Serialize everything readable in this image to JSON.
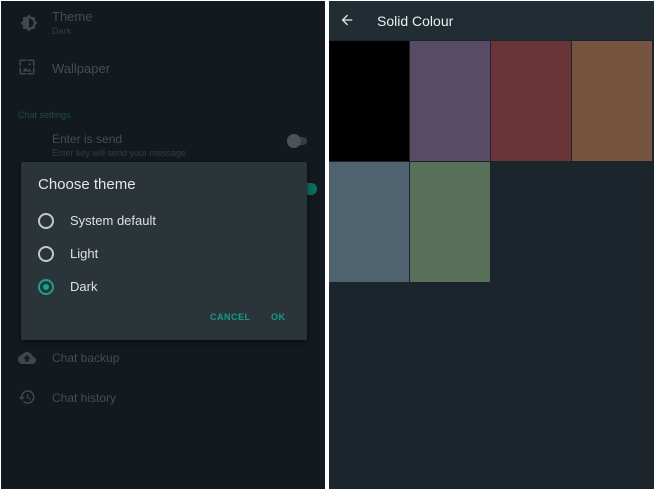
{
  "settings": {
    "theme": {
      "title": "Theme",
      "value": "Dark",
      "icon": "brightness-icon"
    },
    "wallpaper": {
      "title": "Wallpaper",
      "icon": "wallpaper-icon"
    },
    "chat_section": "Chat settings",
    "enter_send": {
      "title": "Enter is send",
      "subtitle": "Enter key will send your message",
      "enabled": false
    },
    "chat_backup": {
      "title": "Chat backup",
      "icon": "cloud-upload-icon"
    },
    "chat_history": {
      "title": "Chat history",
      "icon": "history-icon"
    }
  },
  "dialog": {
    "title": "Choose theme",
    "options": [
      {
        "label": "System default",
        "selected": false
      },
      {
        "label": "Light",
        "selected": false
      },
      {
        "label": "Dark",
        "selected": true
      }
    ],
    "cancel_label": "CANCEL",
    "ok_label": "OK"
  },
  "colour_picker": {
    "title": "Solid Colour",
    "back_icon": "arrow-back-icon",
    "swatches": [
      "#000000",
      "#574b66",
      "#6a3538",
      "#77543f",
      "#4e6270",
      "#58705a"
    ]
  },
  "colors": {
    "accent": "#16a38d"
  }
}
